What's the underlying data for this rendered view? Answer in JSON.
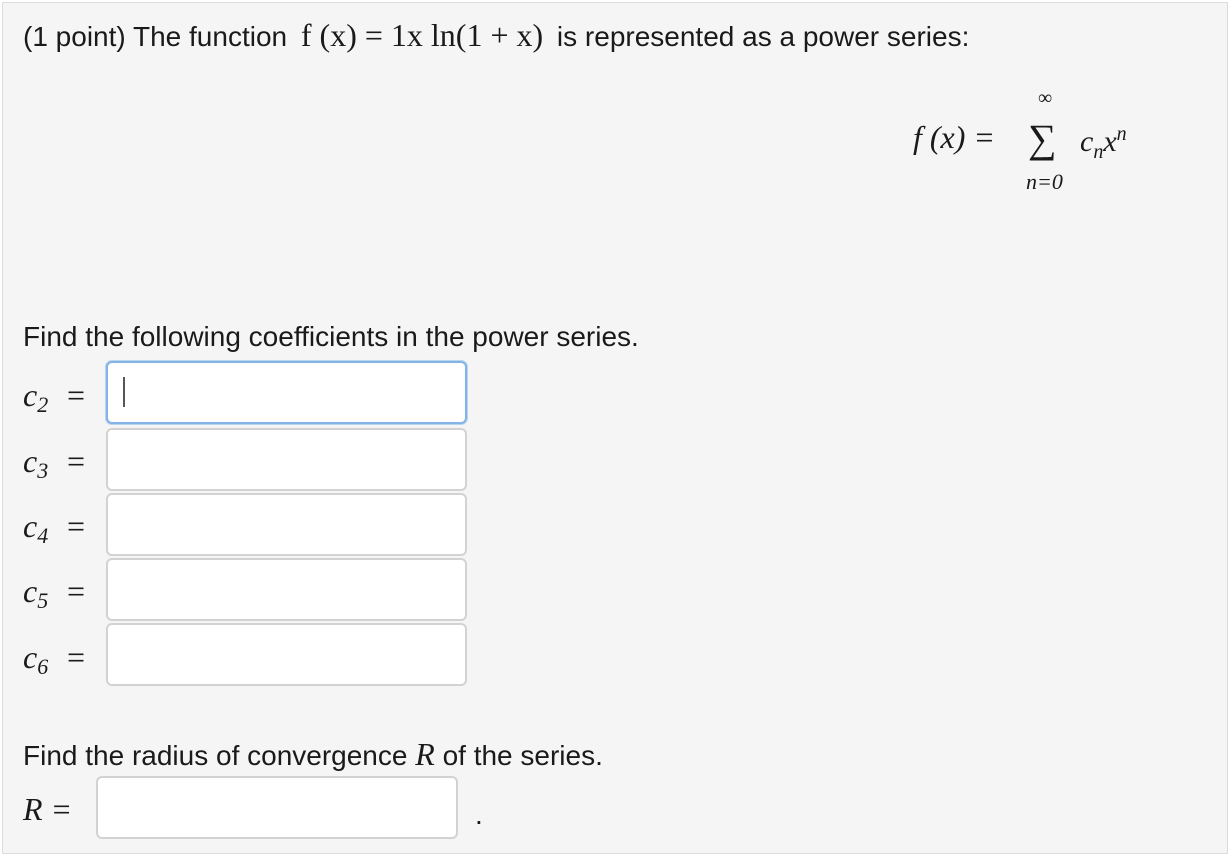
{
  "header": {
    "points_label": "(1 point) The function",
    "function_expression": "f (x) = 1x ln(1 + x)",
    "trailing_text": "is represented as a power series:"
  },
  "series": {
    "lhs": "f (x) =",
    "upper_limit": "∞",
    "sigma": "∑",
    "term": "c",
    "term_sub": "n",
    "term_var": "x",
    "term_sup": "n",
    "lower_limit": "n=0"
  },
  "coefficients_section": {
    "prompt": "Find the following coefficients in the power series.",
    "fields": [
      {
        "name": "c",
        "index": "2",
        "equals": "=",
        "value": ""
      },
      {
        "name": "c",
        "index": "3",
        "equals": "=",
        "value": ""
      },
      {
        "name": "c",
        "index": "4",
        "equals": "=",
        "value": ""
      },
      {
        "name": "c",
        "index": "5",
        "equals": "=",
        "value": ""
      },
      {
        "name": "c",
        "index": "6",
        "equals": "=",
        "value": ""
      }
    ]
  },
  "radius_section": {
    "prompt_before": "Find the radius of convergence",
    "prompt_symbol": "R",
    "prompt_after": "of the series.",
    "label": "R =",
    "value": "",
    "trailing_period": "."
  }
}
